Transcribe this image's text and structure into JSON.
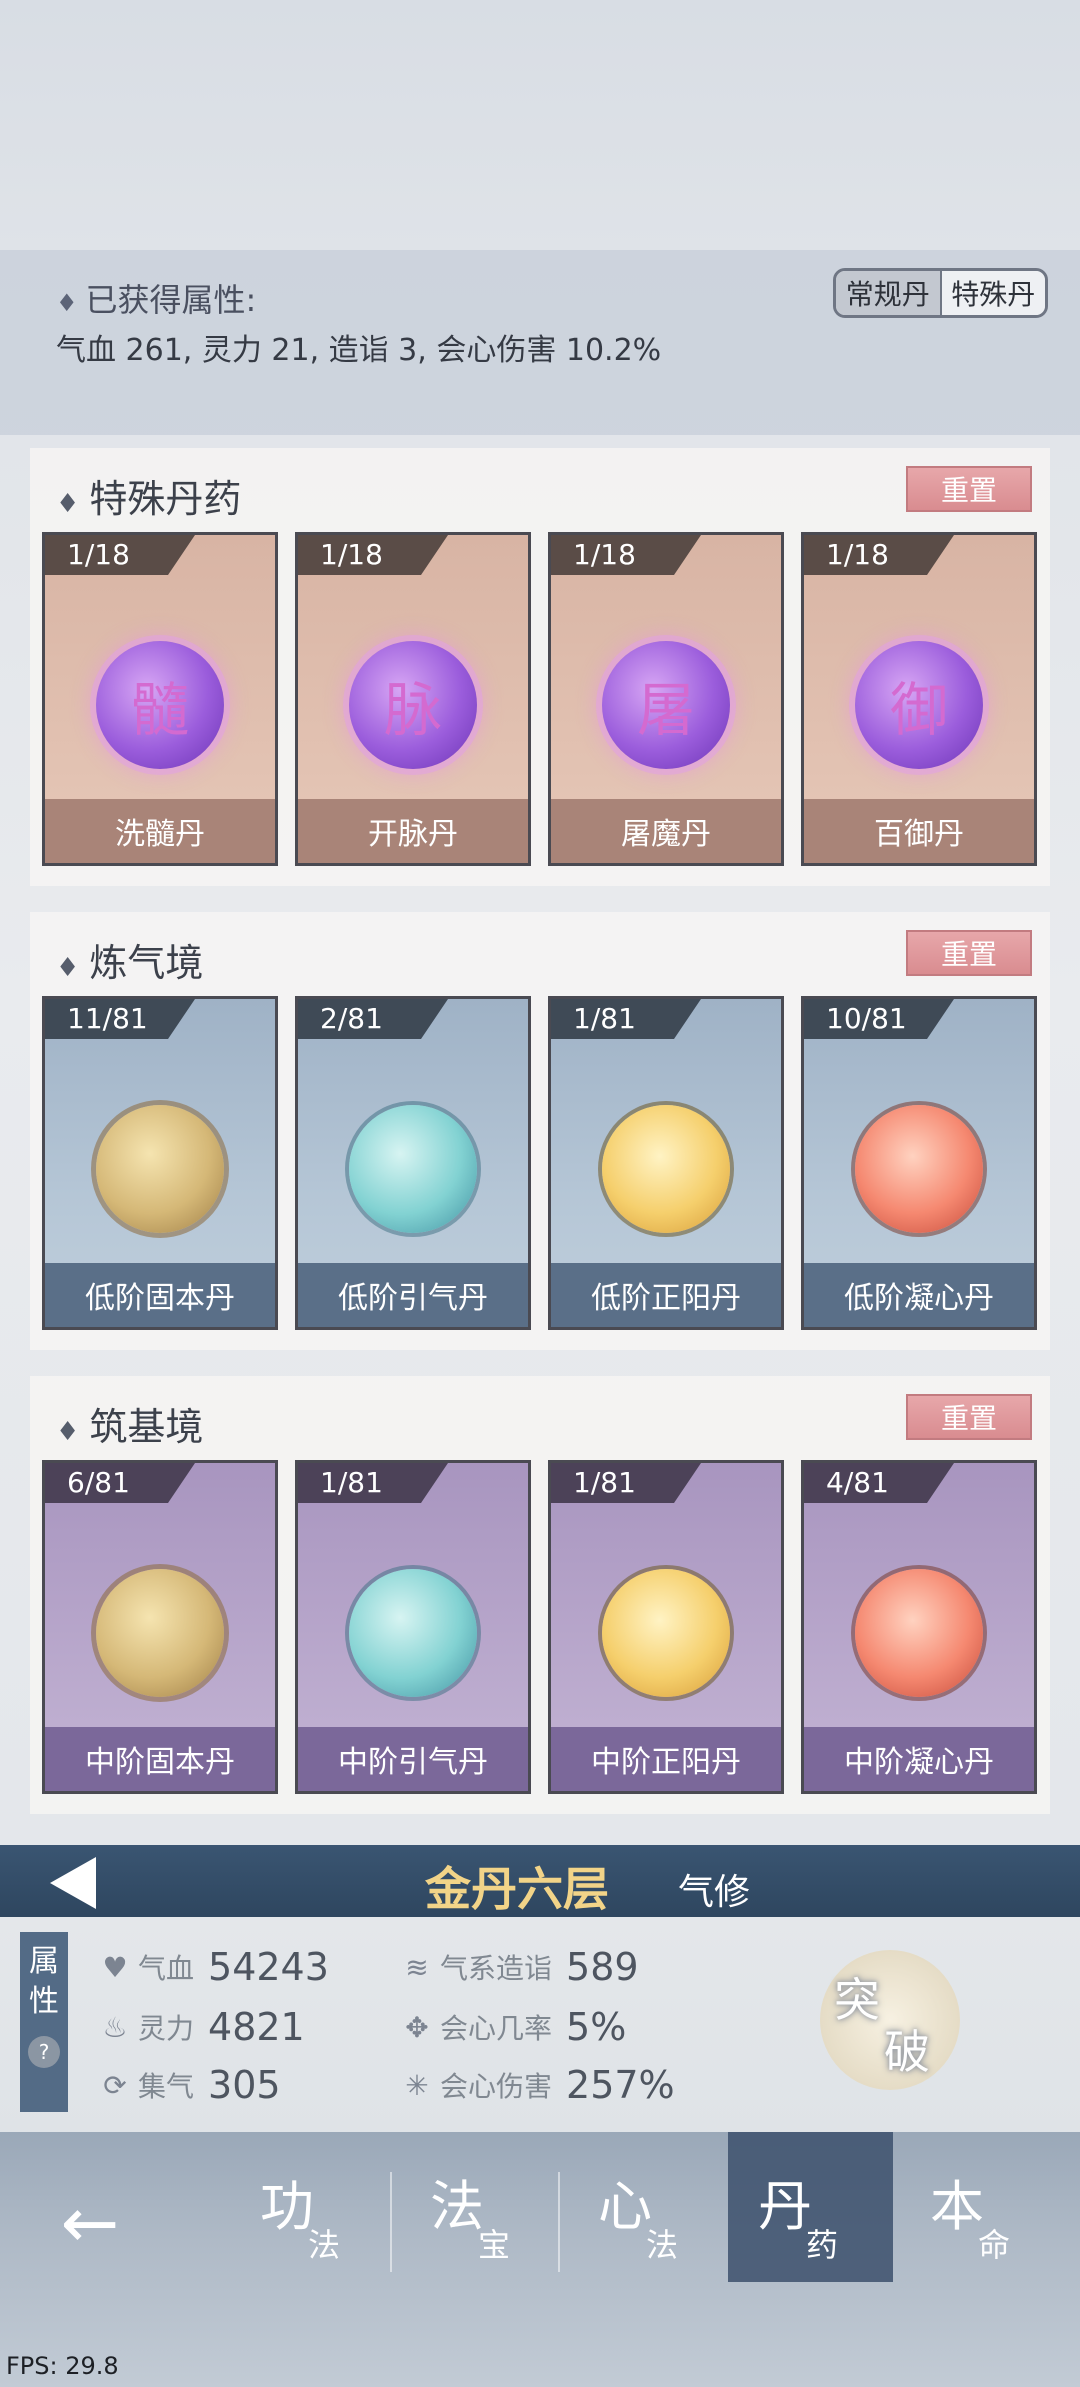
{
  "attributes": {
    "title": "已获得属性:",
    "values": "气血 261, 灵力 21, 造诣 3, 会心伤害 10.2%",
    "toggle": [
      "常规丹",
      "特殊丹"
    ]
  },
  "sections": [
    {
      "title": "特殊丹药",
      "reset_label": "重置",
      "cards": [
        {
          "count": "1/18",
          "name": "洗髓丹"
        },
        {
          "count": "1/18",
          "name": "开脉丹"
        },
        {
          "count": "1/18",
          "name": "屠魔丹"
        },
        {
          "count": "1/18",
          "name": "百御丹"
        }
      ]
    },
    {
      "title": "炼气境",
      "reset_label": "重置",
      "cards": [
        {
          "count": "11/81",
          "name": "低阶固本丹"
        },
        {
          "count": "2/81",
          "name": "低阶引气丹"
        },
        {
          "count": "1/81",
          "name": "低阶正阳丹"
        },
        {
          "count": "10/81",
          "name": "低阶凝心丹"
        }
      ]
    },
    {
      "title": "筑基境",
      "reset_label": "重置",
      "cards": [
        {
          "count": "6/81",
          "name": "中阶固本丹"
        },
        {
          "count": "1/81",
          "name": "中阶引气丹"
        },
        {
          "count": "1/81",
          "name": "中阶正阳丹"
        },
        {
          "count": "4/81",
          "name": "中阶凝心丹"
        }
      ]
    }
  ],
  "realm": {
    "name": "金丹六层",
    "type": "气修"
  },
  "stats": {
    "tab_label_1": "属",
    "tab_label_2": "性",
    "help": "?",
    "items": [
      {
        "name": "气血",
        "value": "54243",
        "icon": "heart-icon"
      },
      {
        "name": "灵力",
        "value": "4821",
        "icon": "flame-icon"
      },
      {
        "name": "集气",
        "value": "305",
        "icon": "swirl-icon"
      },
      {
        "name": "气系造诣",
        "value": "589",
        "icon": "wind-icon"
      },
      {
        "name": "会心几率",
        "value": "5%",
        "icon": "crit-rate-icon"
      },
      {
        "name": "会心伤害",
        "value": "257%",
        "icon": "crit-damage-icon"
      }
    ],
    "breakthrough_1": "突",
    "breakthrough_2": "破"
  },
  "nav": {
    "back": "←",
    "items": [
      {
        "big": "功",
        "small": "法"
      },
      {
        "big": "法",
        "small": "宝"
      },
      {
        "big": "心",
        "small": "法"
      },
      {
        "big": "丹",
        "small": "药"
      },
      {
        "big": "本",
        "small": "命"
      }
    ]
  },
  "fps": "FPS: 29.8",
  "special_glyphs": [
    "髓",
    "脉",
    "屠",
    "御"
  ]
}
